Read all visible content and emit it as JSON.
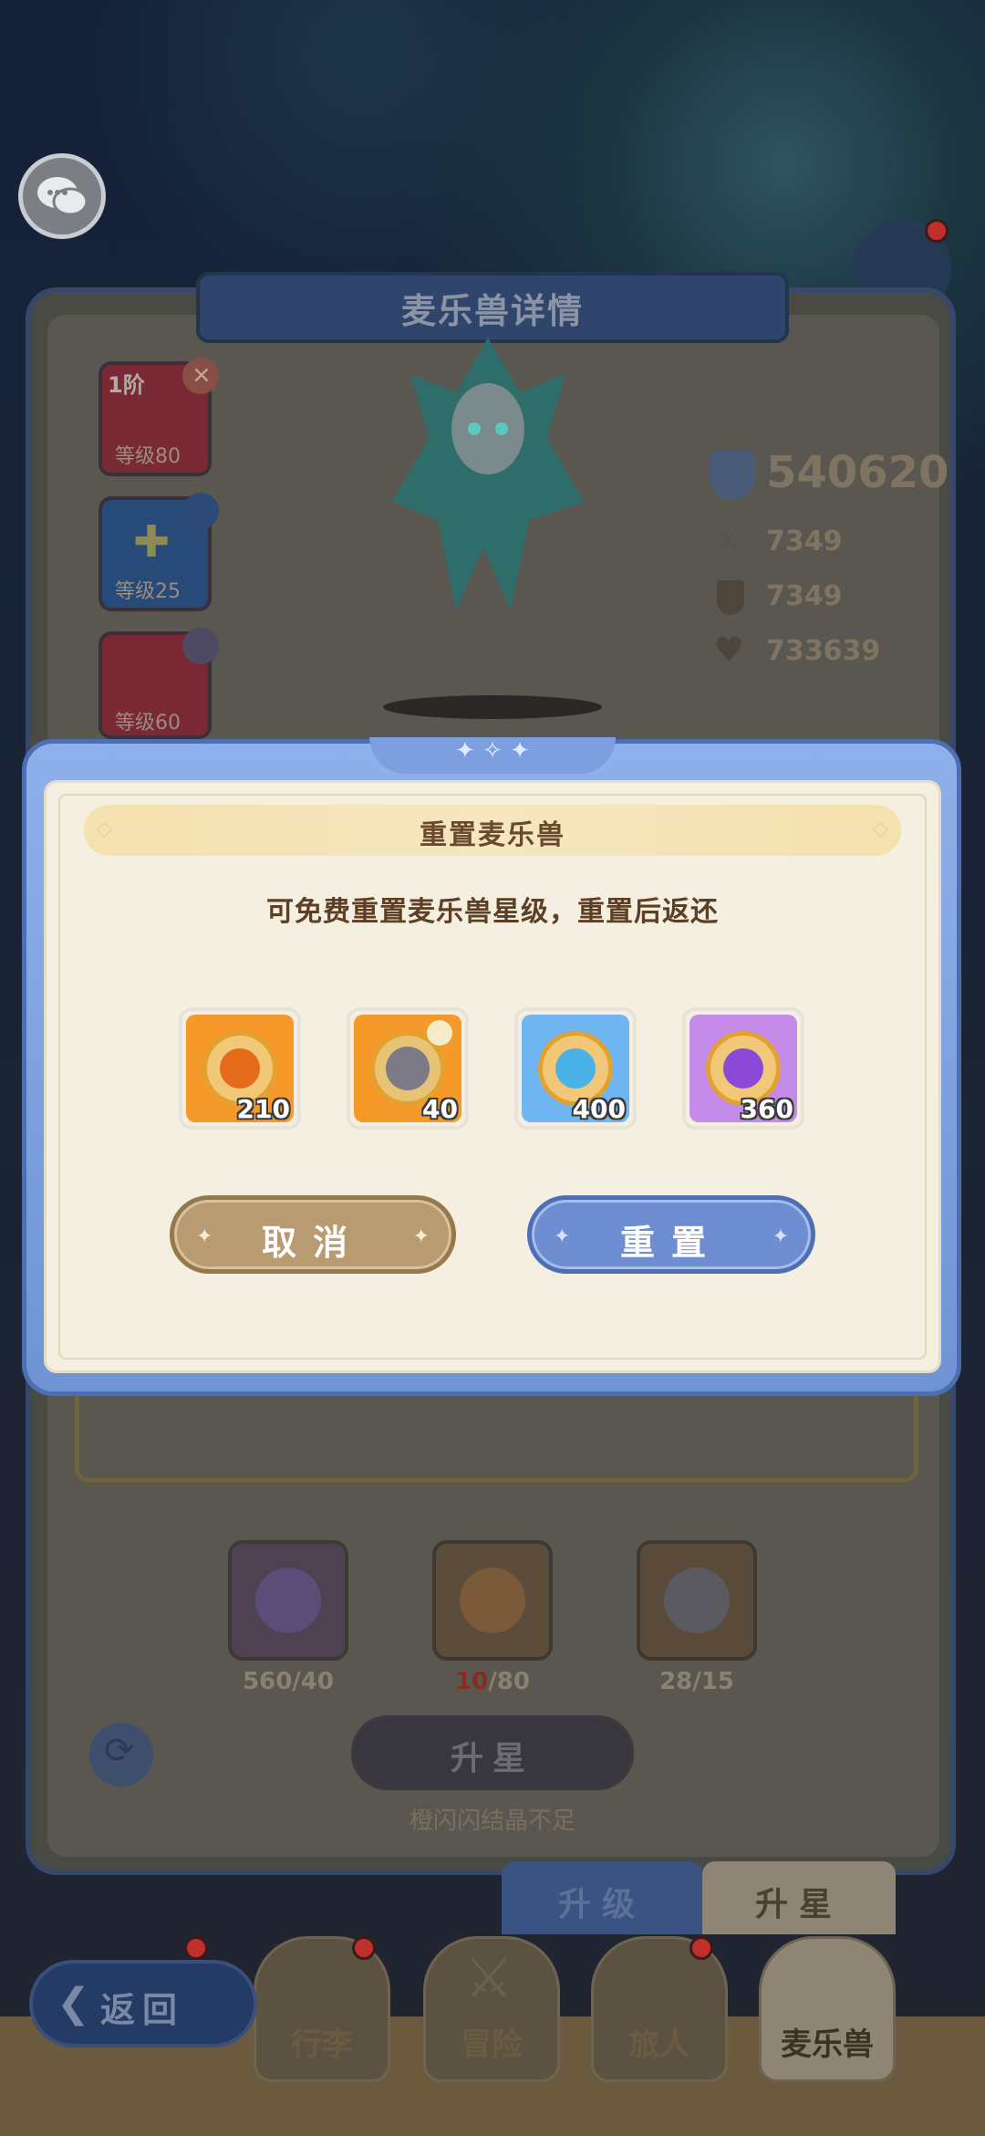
{
  "detail": {
    "title": "麦乐兽详情",
    "skills": [
      {
        "tier": "1阶",
        "level": "等级80"
      },
      {
        "tier": "",
        "level": "等级25"
      },
      {
        "tier": "",
        "level": "等级60"
      }
    ],
    "power": "540620",
    "attack": "7349",
    "defense": "7349",
    "hp": "733639"
  },
  "materials": [
    {
      "count": "560/40"
    },
    {
      "have": "10",
      "need": "/80"
    },
    {
      "count": "28/15"
    }
  ],
  "upstar": {
    "button_label": "升星",
    "hint": "橙闪闪结晶不足"
  },
  "tabs": {
    "level_up": "升级",
    "up_star": "升星"
  },
  "nav": {
    "back": "返回",
    "items": [
      "行李",
      "冒险",
      "旅人",
      "麦乐兽"
    ]
  },
  "dialog": {
    "title": "重置麦乐兽",
    "message": "可免费重置麦乐兽星级，重置后返还",
    "rewards": [
      {
        "icon": "orange-crystal-icon",
        "count": "210",
        "color": "#f59a2a"
      },
      {
        "icon": "gray-beast-shard-icon",
        "count": "40",
        "color": "#f59a2a"
      },
      {
        "icon": "blue-crystal-icon",
        "count": "400",
        "color": "#6fb6f3"
      },
      {
        "icon": "purple-crystal-icon",
        "count": "360",
        "color": "#c48be8"
      }
    ],
    "cancel_label": "取消",
    "reset_label": "重置"
  }
}
